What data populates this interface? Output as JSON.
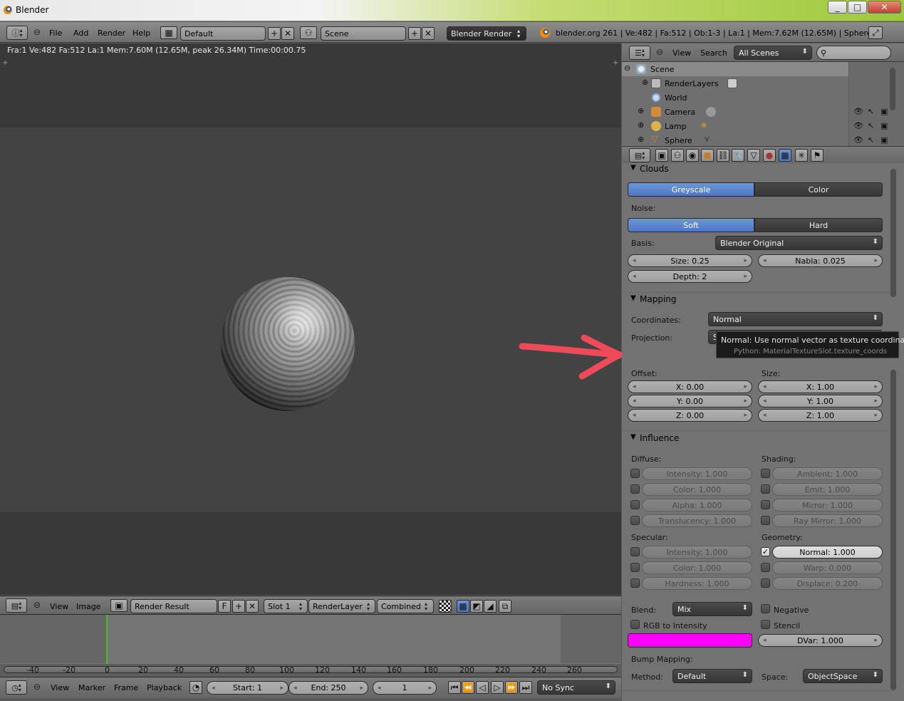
{
  "window": {
    "title": "Blender",
    "minimize": "_",
    "maximize": "□",
    "close": "✕"
  },
  "info_header": {
    "menus": [
      "File",
      "Add",
      "Render",
      "Help"
    ],
    "layout": "Default",
    "scene": "Scene",
    "engine": "Blender Render",
    "stats": "blender.org 261 | Ve:482 | Fa:512 | Ob:1-3 | La:1 | Mem:7.62M (12.65M) | Sphere"
  },
  "viewport": {
    "status": "Fra:1  Ve:482 Fa:512 La:1 Mem:7.60M (12.65M, peak 26.34M) Time:00:00.75"
  },
  "image_editor_header": {
    "menus": [
      "View",
      "Image"
    ],
    "image": "Render Result",
    "fake_user": "F",
    "slot": "Slot 1",
    "layer": "RenderLayer",
    "pass": "Combined"
  },
  "timeline": {
    "ruler_labels": [
      "-40",
      "-20",
      "0",
      "20",
      "40",
      "60",
      "80",
      "100",
      "120",
      "140",
      "160",
      "180",
      "200",
      "220",
      "240",
      "260"
    ],
    "menus": [
      "View",
      "Marker",
      "Frame",
      "Playback"
    ],
    "start": "Start: 1",
    "end": "End: 250",
    "current": "1",
    "sync": "No Sync"
  },
  "outliner": {
    "menus": [
      "View",
      "Search"
    ],
    "filter": "All Scenes",
    "tree": [
      "Scene",
      "RenderLayers",
      "World",
      "Camera",
      "Lamp",
      "Sphere"
    ]
  },
  "properties": {
    "clouds": {
      "title": "Clouds",
      "greyscale": "Greyscale",
      "color": "Color",
      "noise_label": "Noise:",
      "soft": "Soft",
      "hard": "Hard",
      "basis_label": "Basis:",
      "basis": "Blender Original",
      "size": "Size: 0.25",
      "nabla": "Nabla: 0.025",
      "depth": "Depth: 2"
    },
    "mapping": {
      "title": "Mapping",
      "coordinates_label": "Coordinates:",
      "coordinates": "Normal",
      "projection_label": "Projection:",
      "projection_partial": "S",
      "offset_label": "Offset:",
      "size_label": "Size:",
      "offset": [
        "X: 0.00",
        "Y: 0.00",
        "Z: 0.00"
      ],
      "size": [
        "X: 1.00",
        "Y: 1.00",
        "Z: 1.00"
      ]
    },
    "tooltip": {
      "title": "Normal: Use normal vector as texture coordinates",
      "python": "Python: MaterialTextureSlot.texture_coords"
    },
    "influence": {
      "title": "Influence",
      "diffuse_label": "Diffuse:",
      "shading_label": "Shading:",
      "diffuse": [
        "Intensity: 1.000",
        "Color: 1.000",
        "Alpha: 1.000",
        "Translucency: 1.000"
      ],
      "shading": [
        "Ambient: 1.000",
        "Emit: 1.000",
        "Mirror: 1.000",
        "Ray Mirror: 1.000"
      ],
      "specular_label": "Specular:",
      "geometry_label": "Geometry:",
      "specular": [
        "Intensity: 1.000",
        "Color: 1.000",
        "Hardness: 1.000"
      ],
      "geometry": [
        "Normal: 1.000",
        "Warp: 0.000",
        "Displace: 0.200"
      ],
      "blend_label": "Blend:",
      "blend": "Mix",
      "negative": "Negative",
      "rgb_to_intensity": "RGB to Intensity",
      "stencil": "Stencil",
      "dvar": "DVar: 1.000",
      "color_hex": "#ff00ff",
      "bump_label": "Bump Mapping:",
      "method_label": "Method:",
      "method": "Default",
      "space_label": "Space:",
      "space": "ObjectSpace"
    }
  }
}
